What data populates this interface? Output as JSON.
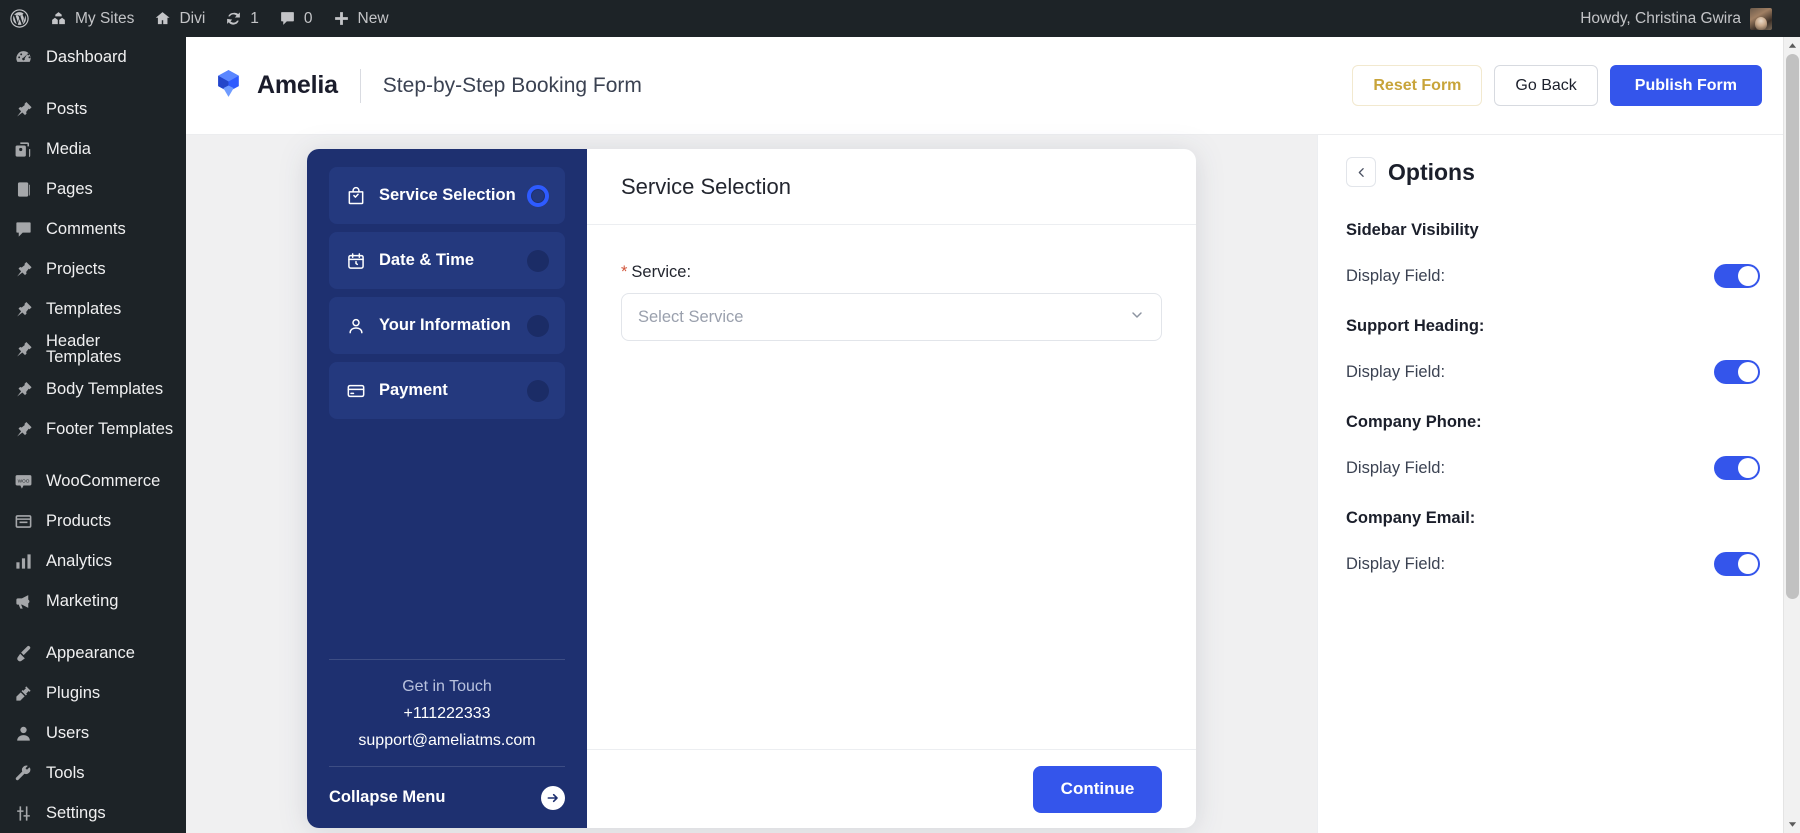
{
  "adminbar": {
    "logo_icon": "wordpress-icon",
    "items": [
      {
        "icon": "sites-icon",
        "label": "My Sites"
      },
      {
        "icon": "home-icon",
        "label": "Divi"
      },
      {
        "icon": "updates-icon",
        "label": "1"
      },
      {
        "icon": "comment-bubble-icon",
        "label": "0"
      },
      {
        "icon": "plus-icon",
        "label": "New"
      }
    ],
    "account": {
      "label": "Howdy, Christina Gwira",
      "avatar": "user-avatar"
    }
  },
  "adminmenu": {
    "items": [
      {
        "icon": "dashboard-icon",
        "label": "Dashboard",
        "sep_after": true
      },
      {
        "icon": "pin-icon",
        "label": "Posts",
        "sep_after": false
      },
      {
        "icon": "media-icon",
        "label": "Media",
        "sep_after": false
      },
      {
        "icon": "pages-icon",
        "label": "Pages",
        "sep_after": false
      },
      {
        "icon": "comments-icon",
        "label": "Comments",
        "sep_after": false
      },
      {
        "icon": "pin-icon",
        "label": "Projects",
        "sep_after": false
      },
      {
        "icon": "pin-icon",
        "label": "Templates",
        "sep_after": false
      },
      {
        "icon": "pin-icon",
        "label": "Header Templates",
        "sep_after": false
      },
      {
        "icon": "pin-icon",
        "label": "Body Templates",
        "sep_after": false
      },
      {
        "icon": "pin-icon",
        "label": "Footer Templates",
        "sep_after": true
      },
      {
        "icon": "woo-icon",
        "label": "WooCommerce",
        "sep_after": false
      },
      {
        "icon": "products-icon",
        "label": "Products",
        "sep_after": false
      },
      {
        "icon": "analytics-icon",
        "label": "Analytics",
        "sep_after": false
      },
      {
        "icon": "marketing-icon",
        "label": "Marketing",
        "sep_after": true
      },
      {
        "icon": "appearance-icon",
        "label": "Appearance",
        "sep_after": false
      },
      {
        "icon": "plugins-icon",
        "label": "Plugins",
        "sep_after": false
      },
      {
        "icon": "users-icon",
        "label": "Users",
        "sep_after": false
      },
      {
        "icon": "tools-icon",
        "label": "Tools",
        "sep_after": false
      },
      {
        "icon": "settings-icon",
        "label": "Settings",
        "sep_after": false
      }
    ]
  },
  "header": {
    "brand_name": "Amelia",
    "brand_icon": "amelia-cube-logo",
    "page_title": "Step-by-Step Booking Form",
    "buttons": {
      "reset": "Reset Form",
      "go_back": "Go Back",
      "publish": "Publish Form"
    }
  },
  "booking_form": {
    "steps": [
      {
        "icon": "bag-check-icon",
        "label": "Service Selection",
        "active": true
      },
      {
        "icon": "calendar-icon",
        "label": "Date & Time",
        "active": false
      },
      {
        "icon": "person-icon",
        "label": "Your Information",
        "active": false
      },
      {
        "icon": "credit-card-icon",
        "label": "Payment",
        "active": false
      }
    ],
    "support": {
      "heading": "Get in Touch",
      "phone": "+111222333",
      "email": "support@ameliatms.com"
    },
    "collapse": {
      "label": "Collapse Menu",
      "icon": "arrow-right-circle-icon"
    },
    "main": {
      "title": "Service Selection",
      "field_required_mark": "*",
      "field_label": "Service:",
      "select_placeholder": "Select Service",
      "select_value": "",
      "select_chevron": "chevron-down-icon",
      "continue_label": "Continue"
    }
  },
  "options_panel": {
    "back_icon": "chevron-left-icon",
    "title": "Options",
    "groups": [
      {
        "title": "Sidebar Visibility",
        "row_label": "Display Field:",
        "enabled": true
      },
      {
        "title": "Support Heading:",
        "row_label": "Display Field:",
        "enabled": true
      },
      {
        "title": "Company Phone:",
        "row_label": "Display Field:",
        "enabled": true
      },
      {
        "title": "Company Email:",
        "row_label": "Display Field:",
        "enabled": true
      }
    ]
  },
  "scrollbar": {
    "up_icon": "caret-up-icon",
    "down_icon": "caret-down-icon"
  },
  "colors": {
    "accent_blue": "#3455eb",
    "sidebar_navy": "#1e3070",
    "wp_dark": "#1d2327",
    "reset_gold": "#c8a43a",
    "required_red": "#d1543a"
  }
}
